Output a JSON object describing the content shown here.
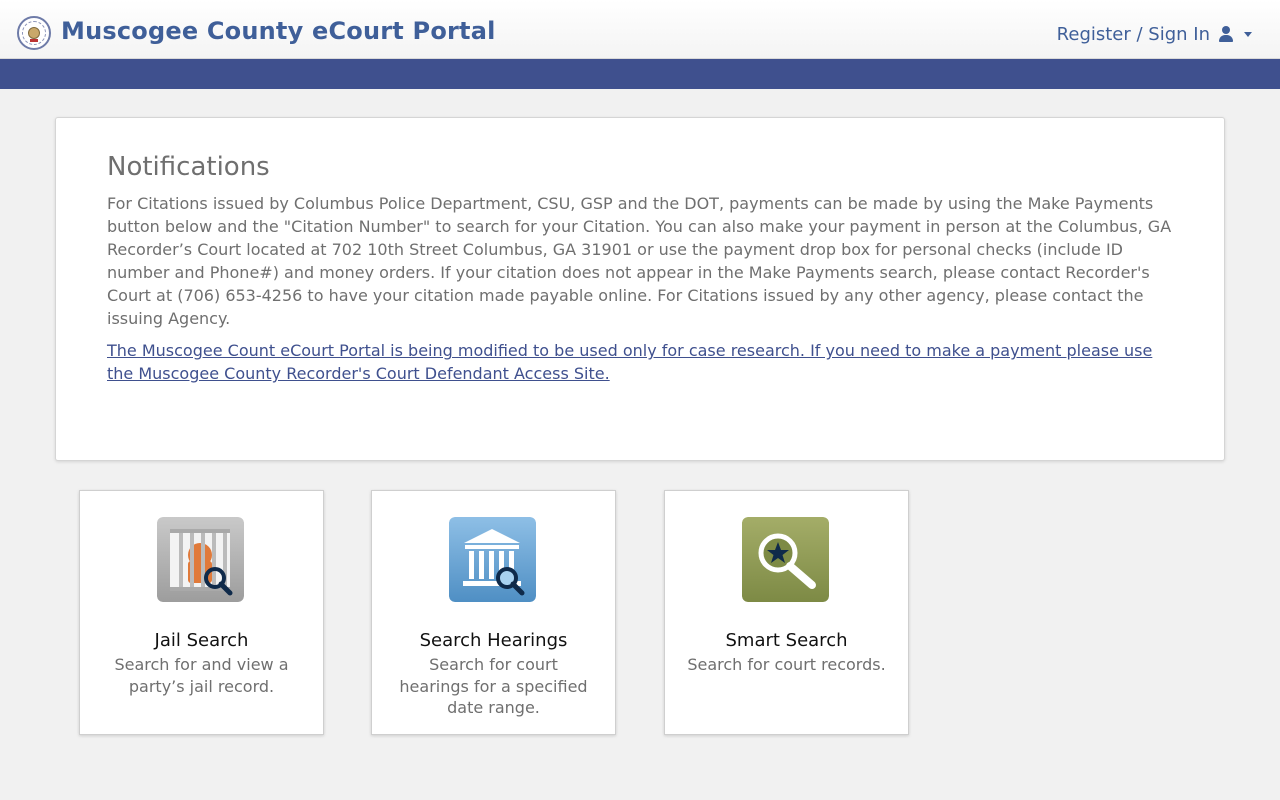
{
  "header": {
    "title": "Muscogee County eCourt Portal",
    "signin_label": "Register / Sign In"
  },
  "notifications": {
    "heading": "Notifications",
    "body": "For Citations issued by Columbus Police Department, CSU, GSP and the DOT, payments can be made by using the Make Payments button below and the \"Citation Number\" to search for your Citation. You can also make your payment in person at the Columbus, GA Recorder’s Court located at 702 10th Street Columbus, GA 31901 or use the payment drop box for personal checks (include ID number and Phone#) and money orders. If your citation does not appear in the Make Payments search, please contact Recorder's Court at (706) 653-4256 to have your citation made payable online. For Citations issued by any other agency, please contact the issuing Agency.",
    "link_text": "The Muscogee Count eCourt Portal is being modified to be used only for case research. If you need to make a payment please use the Muscogee County Recorder's Court Defendant Access Site."
  },
  "tiles": [
    {
      "title": "Jail Search",
      "description": "Search for and view a party’s jail record.",
      "icon": "jail-search-icon"
    },
    {
      "title": "Search Hearings",
      "description": "Search for court hearings for a specified date range.",
      "icon": "courthouse-search-icon"
    },
    {
      "title": "Smart Search",
      "description": "Search for court records.",
      "icon": "smart-search-icon"
    }
  ],
  "colors": {
    "brand": "#3f5f99",
    "nav_bar": "#3f508e",
    "page_bg": "#f1f1f1"
  }
}
